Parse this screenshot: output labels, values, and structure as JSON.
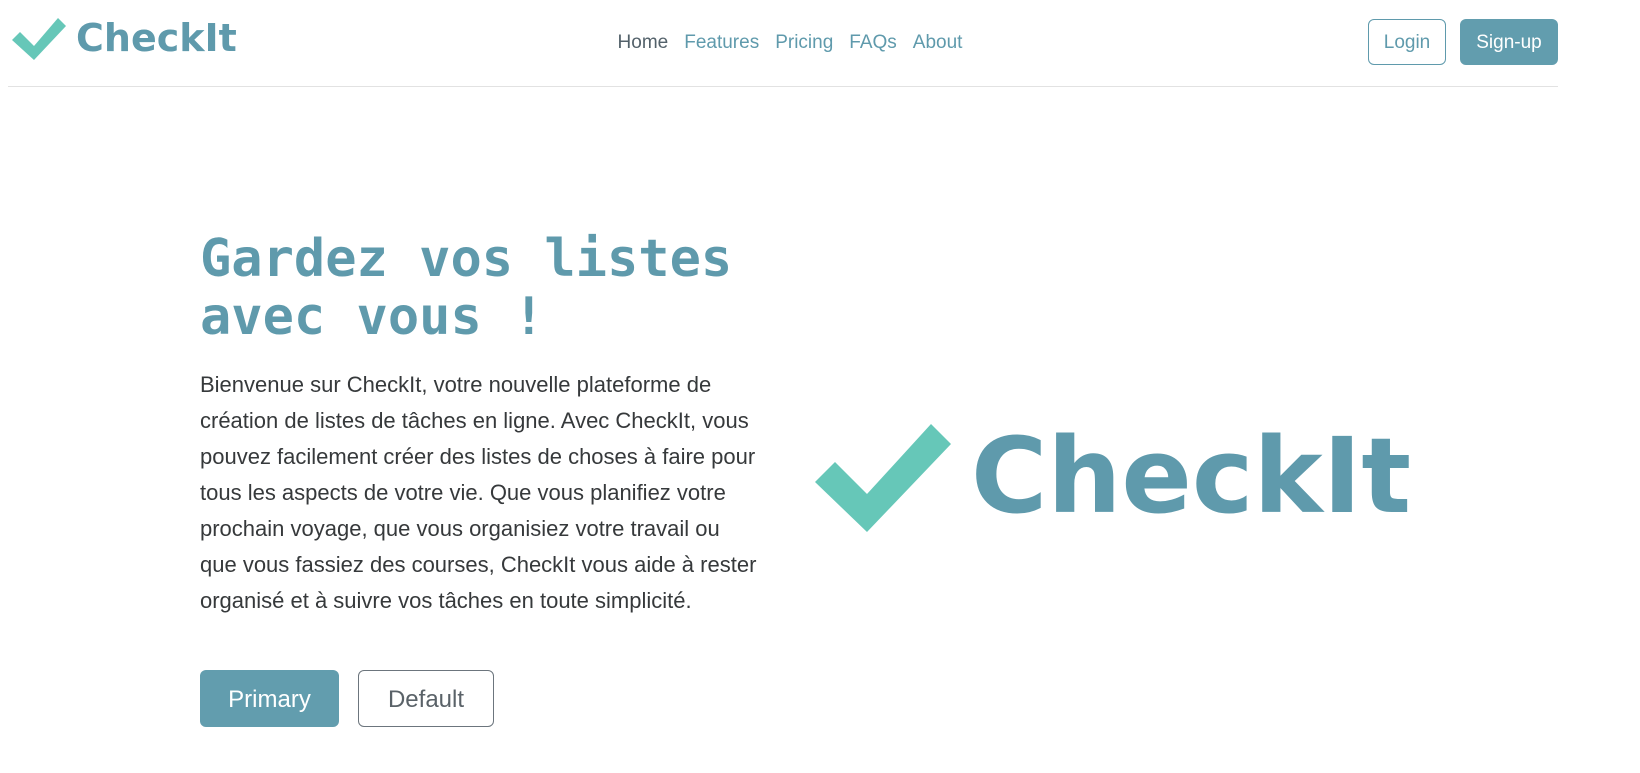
{
  "brand": {
    "name": "CheckIt",
    "check_color": "#66c7b8",
    "text_color": "#5f9aac"
  },
  "nav": {
    "items": [
      {
        "label": "Home",
        "active": true
      },
      {
        "label": "Features",
        "active": false
      },
      {
        "label": "Pricing",
        "active": false
      },
      {
        "label": "FAQs",
        "active": false
      },
      {
        "label": "About",
        "active": false
      }
    ]
  },
  "auth": {
    "login_label": "Login",
    "signup_label": "Sign-up"
  },
  "hero": {
    "title_line1": "Gardez vos listes",
    "title_line2": "avec vous !",
    "description": "Bienvenue sur CheckIt, votre nouvelle plateforme de création de listes de tâches en ligne. Avec CheckIt, vous pouvez facilement créer des listes de choses à faire pour tous les aspects de votre vie. Que vous planifiez votre prochain voyage, que vous organisiez votre travail ou que vous fassiez des courses, CheckIt vous aide à rester organisé et à suivre vos tâches en toute simplicité.",
    "primary_label": "Primary",
    "default_label": "Default",
    "logo_text": "CheckIt"
  },
  "colors": {
    "accent": "#5f9aac",
    "check": "#66c7b8",
    "body_text": "#36393b"
  }
}
